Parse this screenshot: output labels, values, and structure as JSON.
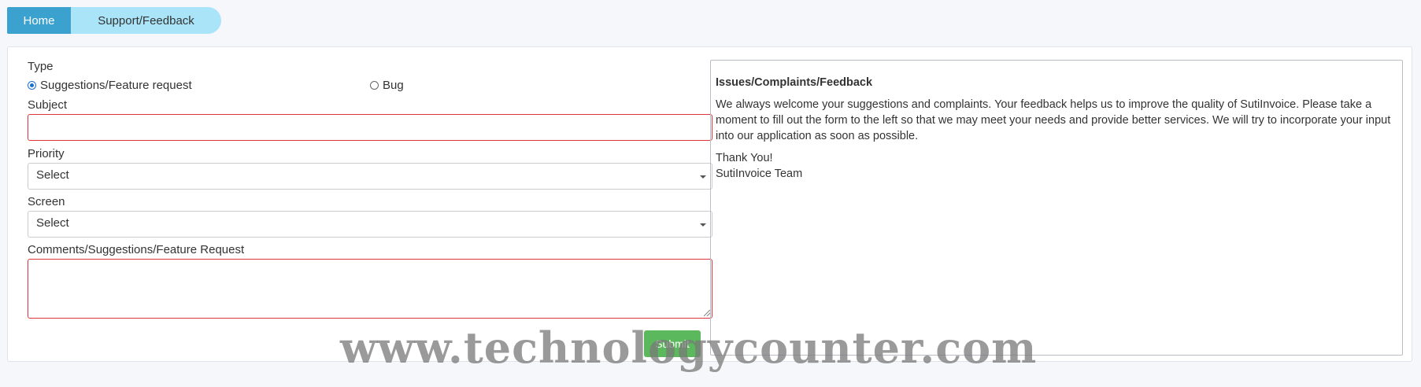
{
  "breadcrumb": {
    "home": "Home",
    "current": "Support/Feedback"
  },
  "form": {
    "type_label": "Type",
    "type_options": [
      {
        "label": "Suggestions/Feature request",
        "checked": true
      },
      {
        "label": "Bug",
        "checked": false
      }
    ],
    "subject_label": "Subject",
    "subject_value": "",
    "priority_label": "Priority",
    "priority_value": "Select",
    "screen_label": "Screen",
    "screen_value": "Select",
    "comments_label": "Comments/Suggestions/Feature Request",
    "comments_value": "",
    "submit_label": "Submit"
  },
  "info": {
    "title": "Issues/Complaints/Feedback",
    "body": "We always welcome your suggestions and complaints. Your feedback helps us to improve the quality of SutiInvoice. Please take a moment to fill out the form to the left so that we may meet your needs and provide better services. We will try to incorporate your input into our application as soon as possible.",
    "thanks": "Thank You!",
    "signature": "SutiInvoice Team"
  },
  "watermark": "www.technologycounter.com",
  "colors": {
    "breadcrumb_home": "#3ba1cf",
    "breadcrumb_current": "#a9e4f8",
    "invalid_border": "#e0343d",
    "submit": "#5cb85c"
  }
}
